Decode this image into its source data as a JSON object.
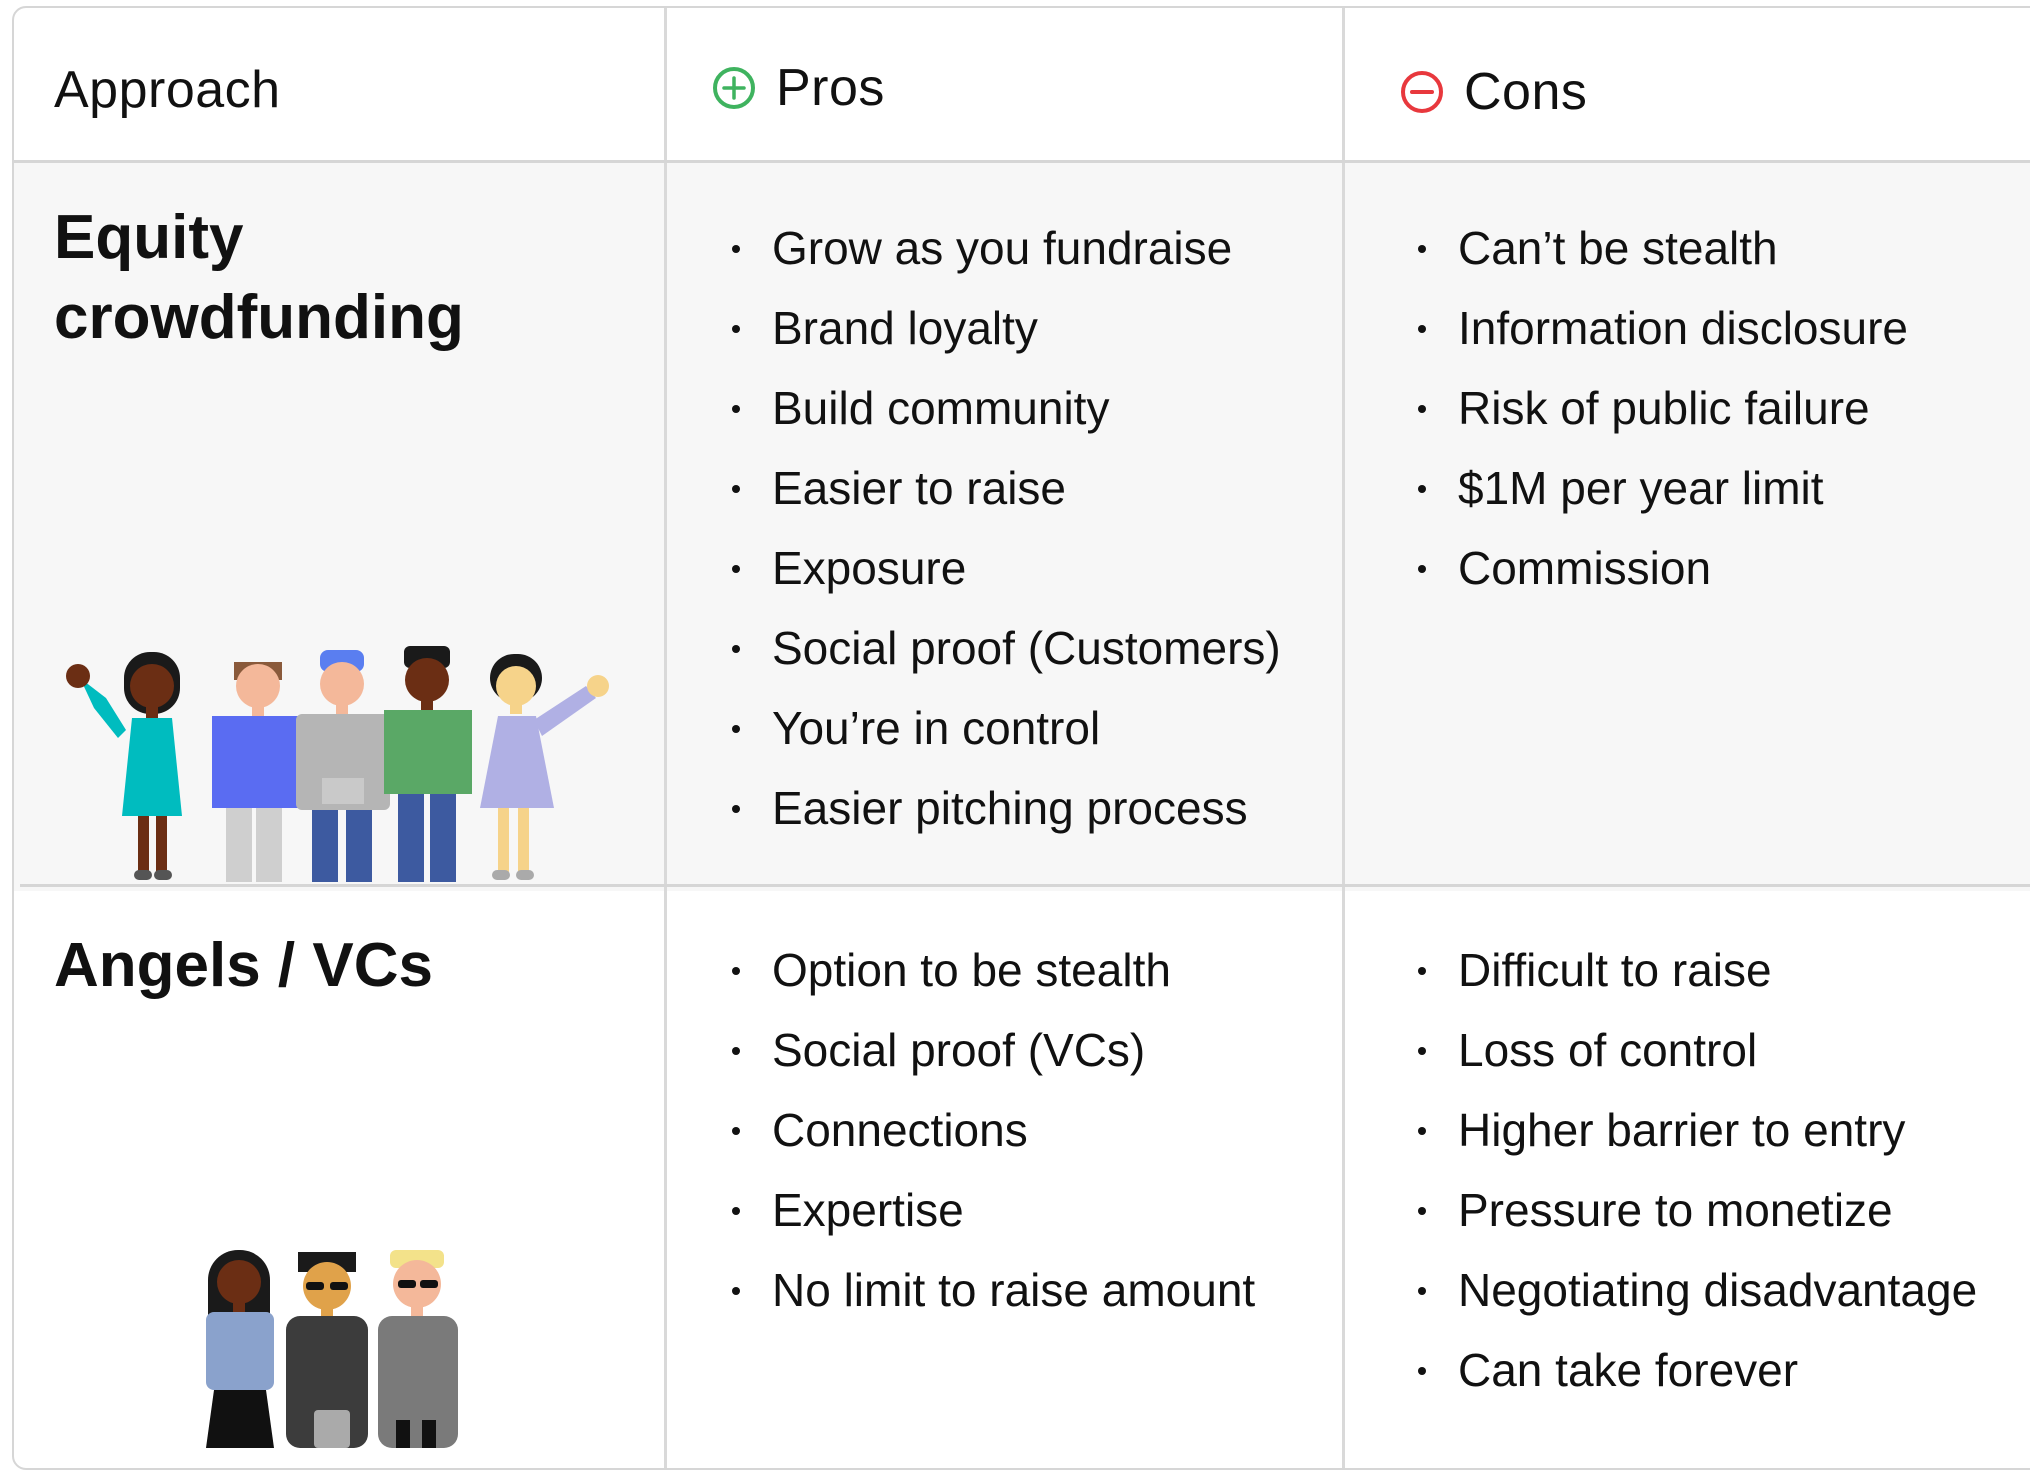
{
  "header": {
    "approach_label": "Approach",
    "pros_label": "Pros",
    "cons_label": "Cons",
    "pros_icon": "plus-circle-icon",
    "cons_icon": "minus-circle-icon",
    "pros_color": "#3fb35f",
    "cons_color": "#e8383d"
  },
  "rows": [
    {
      "title": "Equity crowdfunding",
      "illustration": "crowd-of-people-icon",
      "pros": [
        "Grow as you fundraise",
        "Brand loyalty",
        "Build community",
        "Easier to raise",
        "Exposure",
        "Social proof (Customers)",
        "You’re in control",
        "Easier pitching process"
      ],
      "cons": [
        "Can’t be stealth",
        "Information disclosure",
        "Risk of public failure",
        "$1M per year limit",
        "Commission"
      ]
    },
    {
      "title": "Angels / VCs",
      "illustration": "investors-group-icon",
      "pros": [
        "Option to be stealth",
        "Social proof (VCs)",
        "Connections",
        "Expertise",
        "No limit to raise amount"
      ],
      "cons": [
        "Difficult to raise",
        "Loss of control",
        "Higher barrier to entry",
        "Pressure to monetize",
        "Negotiating disadvantage",
        "Can take forever"
      ]
    }
  ]
}
